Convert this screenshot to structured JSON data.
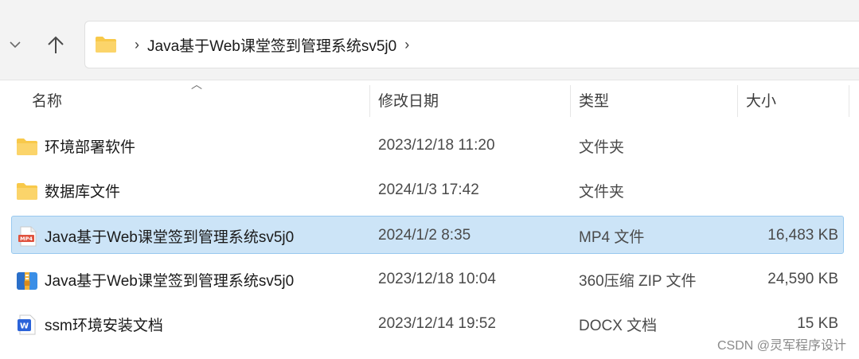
{
  "nav": {
    "breadcrumb": "Java基于Web课堂签到管理系统sv5j0"
  },
  "columns": {
    "name": "名称",
    "modified": "修改日期",
    "type": "类型",
    "size": "大小"
  },
  "files": [
    {
      "name": "环境部署软件",
      "modified": "2023/12/18 11:20",
      "type": "文件夹",
      "size": "",
      "icon": "folder-icon",
      "selected": false
    },
    {
      "name": "数据库文件",
      "modified": "2024/1/3 17:42",
      "type": "文件夹",
      "size": "",
      "icon": "folder-icon",
      "selected": false
    },
    {
      "name": "Java基于Web课堂签到管理系统sv5j0",
      "modified": "2024/1/2 8:35",
      "type": "MP4 文件",
      "size": "16,483 KB",
      "icon": "mp4-file-icon",
      "selected": true
    },
    {
      "name": "Java基于Web课堂签到管理系统sv5j0",
      "modified": "2023/12/18 10:04",
      "type": "360压缩 ZIP 文件",
      "size": "24,590 KB",
      "icon": "zip-archive-icon",
      "selected": false
    },
    {
      "name": "ssm环境安装文档",
      "modified": "2023/12/14 19:52",
      "type": "DOCX 文档",
      "size": "15 KB",
      "icon": "docx-file-icon",
      "selected": false
    }
  ],
  "watermark": "CSDN @灵军程序设计",
  "colors": {
    "selection_bg": "#cce4f7",
    "selection_border": "#99c9ef",
    "folder": "#f8c94a",
    "mp4_red": "#e0533f",
    "docx_blue": "#2b63d9"
  }
}
